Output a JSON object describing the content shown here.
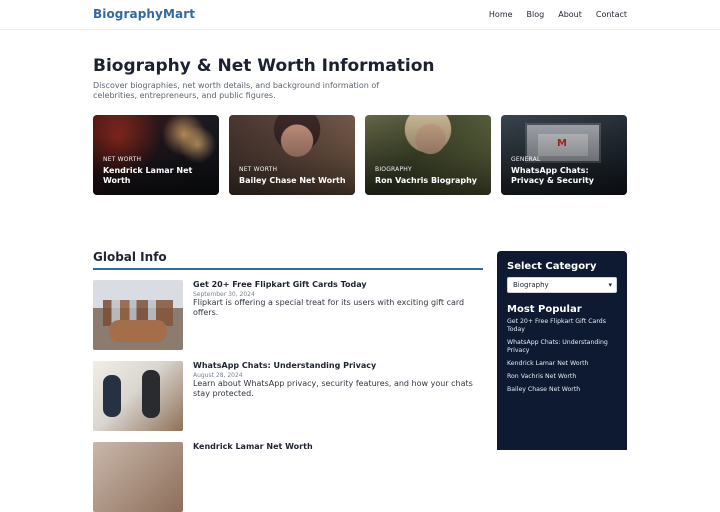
{
  "header": {
    "site_name": "BiographyMart",
    "nav": [
      "Home",
      "Blog",
      "About",
      "Contact"
    ]
  },
  "hero": {
    "title": "Biography & Net Worth Information",
    "subtitle": "Discover biographies, net worth details, and background information of celebrities, entrepreneurs, and public figures."
  },
  "cards": [
    {
      "tag": "NET WORTH",
      "title": "Kendrick Lamar Net Worth"
    },
    {
      "tag": "NET WORTH",
      "title": "Bailey Chase Net Worth"
    },
    {
      "tag": "BIOGRAPHY",
      "title": "Ron Vachris Biography"
    },
    {
      "tag": "GENERAL",
      "title": "WhatsApp Chats: Privacy & Security"
    }
  ],
  "main": {
    "section_title": "Global Info",
    "posts": [
      {
        "title": "Get 20+ Free Flipkart Gift Cards Today",
        "date": "September 30, 2024",
        "excerpt": "Flipkart is offering a special treat for its users with exciting gift card offers."
      },
      {
        "title": "WhatsApp Chats: Understanding Privacy",
        "date": "August 28, 2024",
        "excerpt": "Learn about WhatsApp privacy, security features, and how your chats stay protected."
      },
      {
        "title": "Kendrick Lamar Net Worth",
        "date": "",
        "excerpt": ""
      }
    ]
  },
  "sidebar": {
    "category_heading": "Select Category",
    "selected_category": "Biography",
    "popular_heading": "Most Popular",
    "popular_items": [
      "Get 20+ Free Flipkart Gift Cards Today",
      "WhatsApp Chats: Understanding Privacy",
      "Kendrick Lamar Net Worth",
      "Ron Vachris Net Worth",
      "Bailey Chase Net Worth"
    ]
  },
  "colors": {
    "brand": "#2f6aa5",
    "sidebar_bg": "#0e1a31"
  }
}
